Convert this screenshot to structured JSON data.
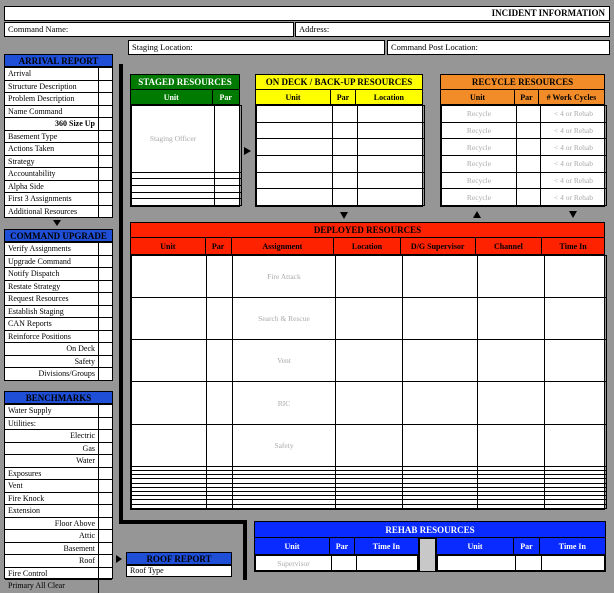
{
  "header": {
    "title": "INCIDENT INFORMATION",
    "command_name_label": "Command Name:",
    "address_label": "Address:",
    "staging_label": "Staging Location:",
    "command_post_label": "Command Post Location:"
  },
  "arrival_report": {
    "title": "ARRIVAL REPORT",
    "items": [
      "Arrival",
      "Structure Description",
      "Problem Description",
      "Name Command",
      "360 Size Up",
      "Basement Type",
      "Actions Taken",
      "Strategy",
      "Accountability",
      "Alpha Side",
      "First 3 Assignments",
      "Additional Resources"
    ]
  },
  "command_upgrade": {
    "title": "COMMAND UPGRADE",
    "items": [
      "Verify Assignments",
      "Upgrade Command",
      "Notify Dispatch",
      "Restate Strategy",
      "Request Resources",
      "Establish Staging",
      "CAN Reports",
      "Reinforce Positions",
      "On Deck",
      "Safety",
      "Divisions/Groups"
    ]
  },
  "benchmarks": {
    "title": "BENCHMARKS",
    "items": [
      "Water Supply",
      "Utilities:",
      "Electric",
      "Gas",
      "Water",
      "Exposures",
      "Vent",
      "Fire Knock",
      "Extension",
      "Floor Above",
      "Attic",
      "Basement",
      "Roof",
      "Fire Control",
      "Primary All Clear"
    ],
    "utilities_label": "Utilities:"
  },
  "roof_report": {
    "title": "ROOF REPORT",
    "first_item": "Roof Type"
  },
  "staged": {
    "title": "STAGED RESOURCES",
    "headers": [
      "Unit",
      "Par"
    ],
    "placeholder": "Staging Officer"
  },
  "ondeck": {
    "title": "ON DECK / BACK-UP RESOURCES",
    "headers": [
      "Unit",
      "Par",
      "Location"
    ]
  },
  "recycle": {
    "title": "RECYCLE RESOURCES",
    "headers": [
      "Unit",
      "Par",
      "# Work Cycles"
    ],
    "unit_placeholder": "Recycle",
    "cycles_placeholder": "< 4 or Rehab"
  },
  "deployed": {
    "title": "DEPLOYED RESOURCES",
    "headers": [
      "Unit",
      "Par",
      "Assignment",
      "Location",
      "D/G Supervisor",
      "Channel",
      "Time In"
    ],
    "assignments": [
      "Fire Attack",
      "Search & Rescue",
      "Vent",
      "RIC",
      "Safety"
    ]
  },
  "rehab": {
    "title": "REHAB RESOURCES",
    "headers_left": [
      "Unit",
      "Par",
      "Time In"
    ],
    "headers_right": [
      "Unit",
      "Par",
      "Time In"
    ],
    "placeholder": "Supervisor"
  },
  "colors": {
    "staged": "#007a00",
    "ondeck": "#ffff00",
    "recycle": "#f28c28",
    "deployed": "#ff2200",
    "rehab": "#0a2bff",
    "left_header": "#1f4fd6"
  }
}
